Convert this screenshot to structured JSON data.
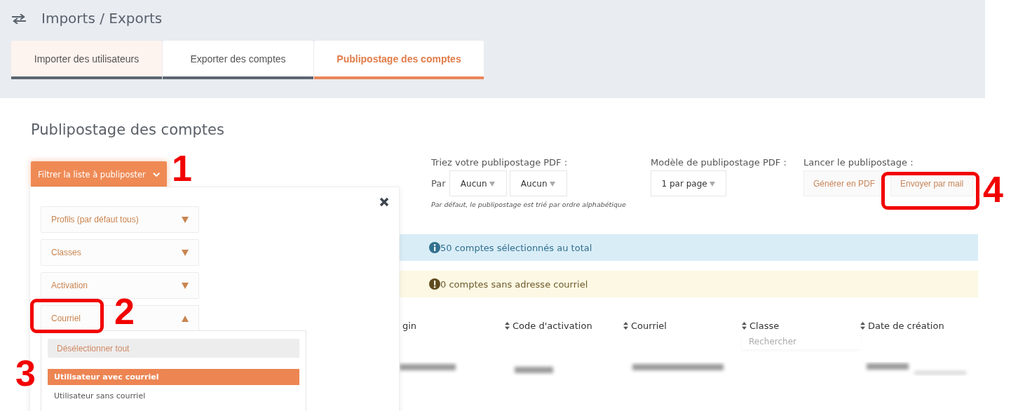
{
  "header": {
    "title": "Imports / Exports"
  },
  "tabs": [
    {
      "label": "Importer des utilisateurs",
      "selected": false
    },
    {
      "label": "Exporter des comptes",
      "selected": false
    },
    {
      "label": "Publipostage des comptes",
      "selected": true
    }
  ],
  "page_title": "Publipostage des comptes",
  "filter_button": {
    "label": "Filtrer la liste à publiposter",
    "expanded": true
  },
  "filter_panel": {
    "sections": [
      {
        "label": "Profils (par défaut tous)",
        "expanded": false
      },
      {
        "label": "Classes",
        "expanded": false
      },
      {
        "label": "Activation",
        "expanded": false
      },
      {
        "label": "Courriel",
        "expanded": true,
        "options": [
          {
            "label": "Désélectionner tout",
            "kind": "action"
          },
          {
            "label": "Utilisateur avec courriel",
            "kind": "option",
            "selected": true
          },
          {
            "label": "Utilisateur sans courriel",
            "kind": "option",
            "selected": false
          }
        ]
      }
    ]
  },
  "sort": {
    "label": "Triez votre publipostage PDF :",
    "prefix": "Par",
    "selects": [
      "Aucun",
      "Aucun"
    ],
    "note": "Par défaut, le publipostage est trié par ordre alphabétique"
  },
  "model": {
    "label": "Modèle de publipostage PDF :",
    "select": "1 par page"
  },
  "launch": {
    "label": "Lancer le publipostage :",
    "buttons": [
      "Générer en PDF",
      "Envoyer par mail"
    ]
  },
  "alerts": [
    {
      "kind": "info",
      "text": "50 comptes sélectionnés au total"
    },
    {
      "kind": "warning",
      "text": "0 comptes sans adresse courriel"
    }
  ],
  "table": {
    "columns": [
      {
        "label": "gin",
        "sortable": false
      },
      {
        "label": "Code d'activation",
        "sortable": true
      },
      {
        "label": "Courriel",
        "sortable": true
      },
      {
        "label": "Classe",
        "sortable": true
      },
      {
        "label": "Date de création",
        "sortable": true
      }
    ],
    "search_placeholder": "Rechercher"
  },
  "annotations": [
    {
      "number": "1",
      "highlight": false
    },
    {
      "number": "2",
      "highlight": true
    },
    {
      "number": "3",
      "highlight": false
    },
    {
      "number": "4",
      "highlight": true
    }
  ]
}
